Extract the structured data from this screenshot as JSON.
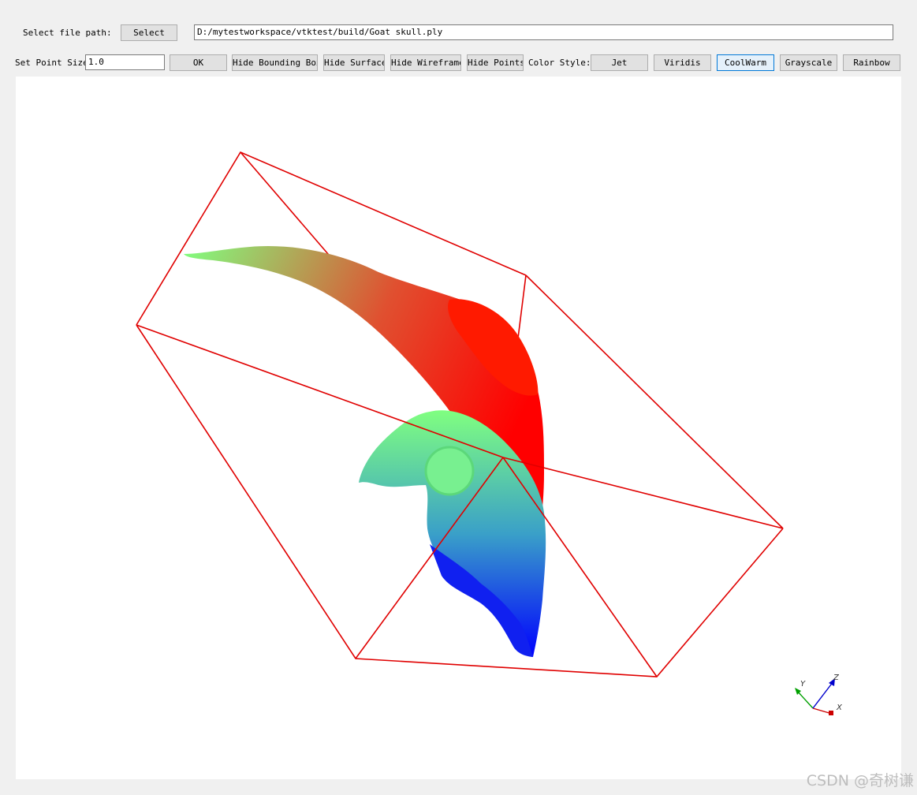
{
  "file_row": {
    "label": "Select file path:",
    "select_button": "Select",
    "path_value": "D:/mytestworkspace/vtktest/build/Goat skull.ply"
  },
  "toolbar": {
    "point_size_label": "Set Point Size",
    "point_size_value": "1.0",
    "ok_button": "OK",
    "hide_bounding_box": "Hide Bounding Box",
    "hide_surface": "Hide Surface",
    "hide_wireframe": "Hide Wireframe",
    "hide_points": "Hide Points",
    "color_style_label": "Color Style:",
    "color_styles": [
      "Jet",
      "Viridis",
      "CoolWarm",
      "Grayscale",
      "Rainbow"
    ],
    "active_color_style": "CoolWarm"
  },
  "viewport": {
    "background": "#ffffff",
    "bounding_box_color": "#e00000",
    "gradient_colors": [
      "#0000ff",
      "#80ff80",
      "#ff0000"
    ],
    "axes": {
      "x_label": "X",
      "y_label": "Y",
      "z_label": "Z",
      "x_color": "#cc0000",
      "y_color": "#00a000",
      "z_color": "#0000cc"
    }
  },
  "watermark": "CSDN @奇树谦"
}
